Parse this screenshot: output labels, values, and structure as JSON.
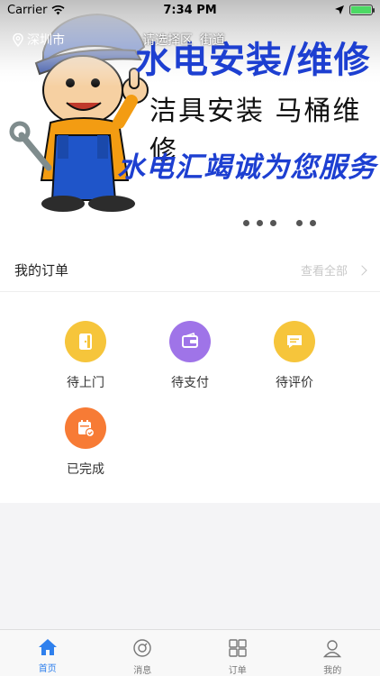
{
  "status": {
    "carrier": "Carrier",
    "time": "7:34 PM",
    "battery_level": 1.0
  },
  "location": {
    "city": "深圳市",
    "district_prompt": "请选择区",
    "street": "街道"
  },
  "banner": {
    "headline": "水电安装/维修",
    "subline": "洁具安装  马桶维修",
    "slogan": "水电汇竭诚为您服务"
  },
  "orders": {
    "title": "我的订单",
    "view_all": "查看全部",
    "items": [
      {
        "label": "待上门",
        "icon": "door-icon",
        "color": "#f6c53b"
      },
      {
        "label": "待支付",
        "icon": "wallet-icon",
        "color": "#9f74e8"
      },
      {
        "label": "待评价",
        "icon": "comment-icon",
        "color": "#f6c53b"
      },
      {
        "label": "已完成",
        "icon": "completed-calendar-icon",
        "color": "#f77b35"
      }
    ]
  },
  "tabs": [
    {
      "label": "首页",
      "icon": "home-icon",
      "active": true
    },
    {
      "label": "消息",
      "icon": "message-icon",
      "active": false
    },
    {
      "label": "订单",
      "icon": "orders-grid-icon",
      "active": false
    },
    {
      "label": "我的",
      "icon": "profile-icon",
      "active": false
    }
  ],
  "colors": {
    "accent": "#2f80ed",
    "banner_blue": "#1d3fd1"
  }
}
